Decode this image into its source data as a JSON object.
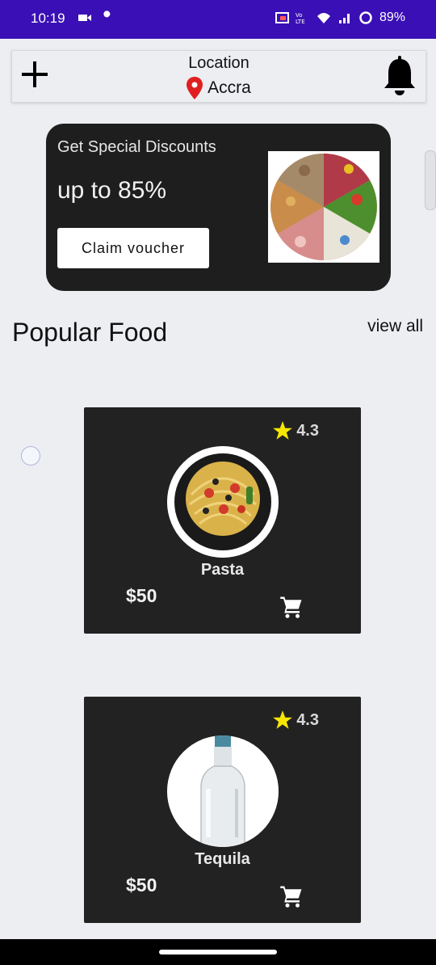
{
  "status_bar": {
    "time": "10:19",
    "battery": "89%",
    "icons": [
      "video-icon",
      "wrench-icon",
      "cast-icon",
      "volte-icon",
      "wifi-icon",
      "signal-icon",
      "battery-ring-icon"
    ]
  },
  "header": {
    "add_icon": "plus-icon",
    "location_title": "Location",
    "location_icon": "map-pin-icon",
    "city": "Accra",
    "bell_icon": "bell-icon"
  },
  "promo": {
    "subtitle": "Get Special Discounts",
    "headline": "up to 85%",
    "button_label": "Claim voucher"
  },
  "section": {
    "title": "Popular Food",
    "view_all": "view all"
  },
  "foods": [
    {
      "name": "Pasta",
      "rating": "4.3",
      "price": "$50"
    },
    {
      "name": "Tequila",
      "rating": "4.3",
      "price": "$50"
    }
  ],
  "colors": {
    "status_bar": "#3a0fb5",
    "card_bg": "#222222",
    "star": "#f7e600",
    "pin": "#e02020"
  }
}
